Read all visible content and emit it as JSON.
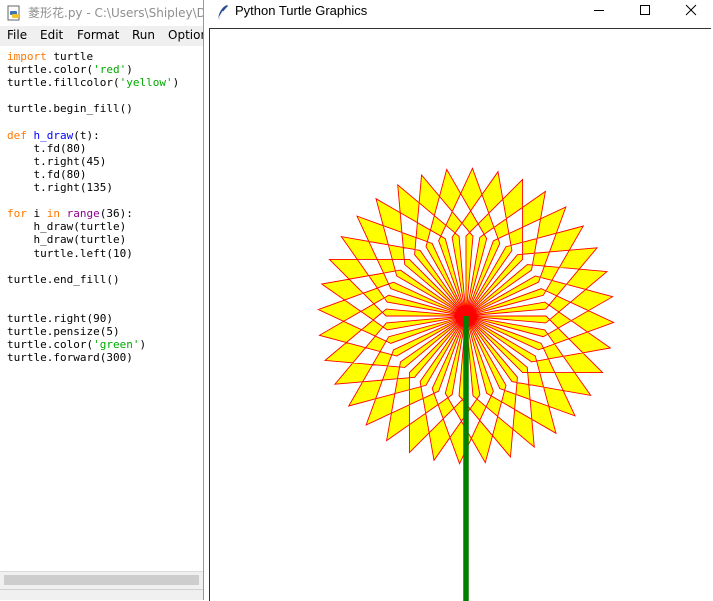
{
  "editor": {
    "title": "菱形花.py - C:\\Users\\Shipley\\D",
    "menu": [
      "File",
      "Edit",
      "Format",
      "Run",
      "Option"
    ],
    "code": [
      [
        [
          "kw",
          "import"
        ],
        [
          "t",
          " turtle"
        ]
      ],
      [
        [
          "t",
          "turtle.color("
        ],
        [
          "str",
          "'red'"
        ],
        [
          "t",
          ")"
        ]
      ],
      [
        [
          "t",
          "turtle.fillcolor("
        ],
        [
          "str",
          "'yellow'"
        ],
        [
          "t",
          ")"
        ]
      ],
      [],
      [
        [
          "t",
          "turtle.begin_fill()"
        ]
      ],
      [],
      [
        [
          "kw",
          "def"
        ],
        [
          "t",
          " "
        ],
        [
          "def",
          "h_draw"
        ],
        [
          "t",
          "(t):"
        ]
      ],
      [
        [
          "t",
          "    t.fd(80)"
        ]
      ],
      [
        [
          "t",
          "    t.right(45)"
        ]
      ],
      [
        [
          "t",
          "    t.fd(80)"
        ]
      ],
      [
        [
          "t",
          "    t.right(135)"
        ]
      ],
      [],
      [
        [
          "kw",
          "for"
        ],
        [
          "t",
          " i "
        ],
        [
          "kw",
          "in"
        ],
        [
          "t",
          " "
        ],
        [
          "bi",
          "range"
        ],
        [
          "t",
          "(36):"
        ]
      ],
      [
        [
          "t",
          "    h_draw(turtle)"
        ]
      ],
      [
        [
          "t",
          "    h_draw(turtle)"
        ]
      ],
      [
        [
          "t",
          "    turtle.left(10)"
        ]
      ],
      [],
      [
        [
          "t",
          "turtle.end_fill()"
        ]
      ],
      [],
      [],
      [
        [
          "t",
          "turtle.right(90)"
        ]
      ],
      [
        [
          "t",
          "turtle.pensize(5)"
        ]
      ],
      [
        [
          "t",
          "turtle.color("
        ],
        [
          "str",
          "'green'"
        ],
        [
          "t",
          ")"
        ]
      ],
      [
        [
          "t",
          "turtle.forward(300)"
        ]
      ]
    ]
  },
  "turtle_window": {
    "title": "Python Turtle Graphics",
    "buttons": [
      "minimize",
      "maximize",
      "close"
    ],
    "drawing": {
      "pen_color": "#ff0000",
      "fill_color": "#ffff00",
      "stem_color": "#007f00",
      "segment_length": 80,
      "turn_angle_deg": 45,
      "return_angle_deg": 135,
      "petal_count": 36,
      "rotate_step_deg": 10,
      "stem_pensize": 5,
      "stem_length": 300
    }
  },
  "icons": {
    "editor": "python-file-icon",
    "turtle": "feather-icon"
  }
}
